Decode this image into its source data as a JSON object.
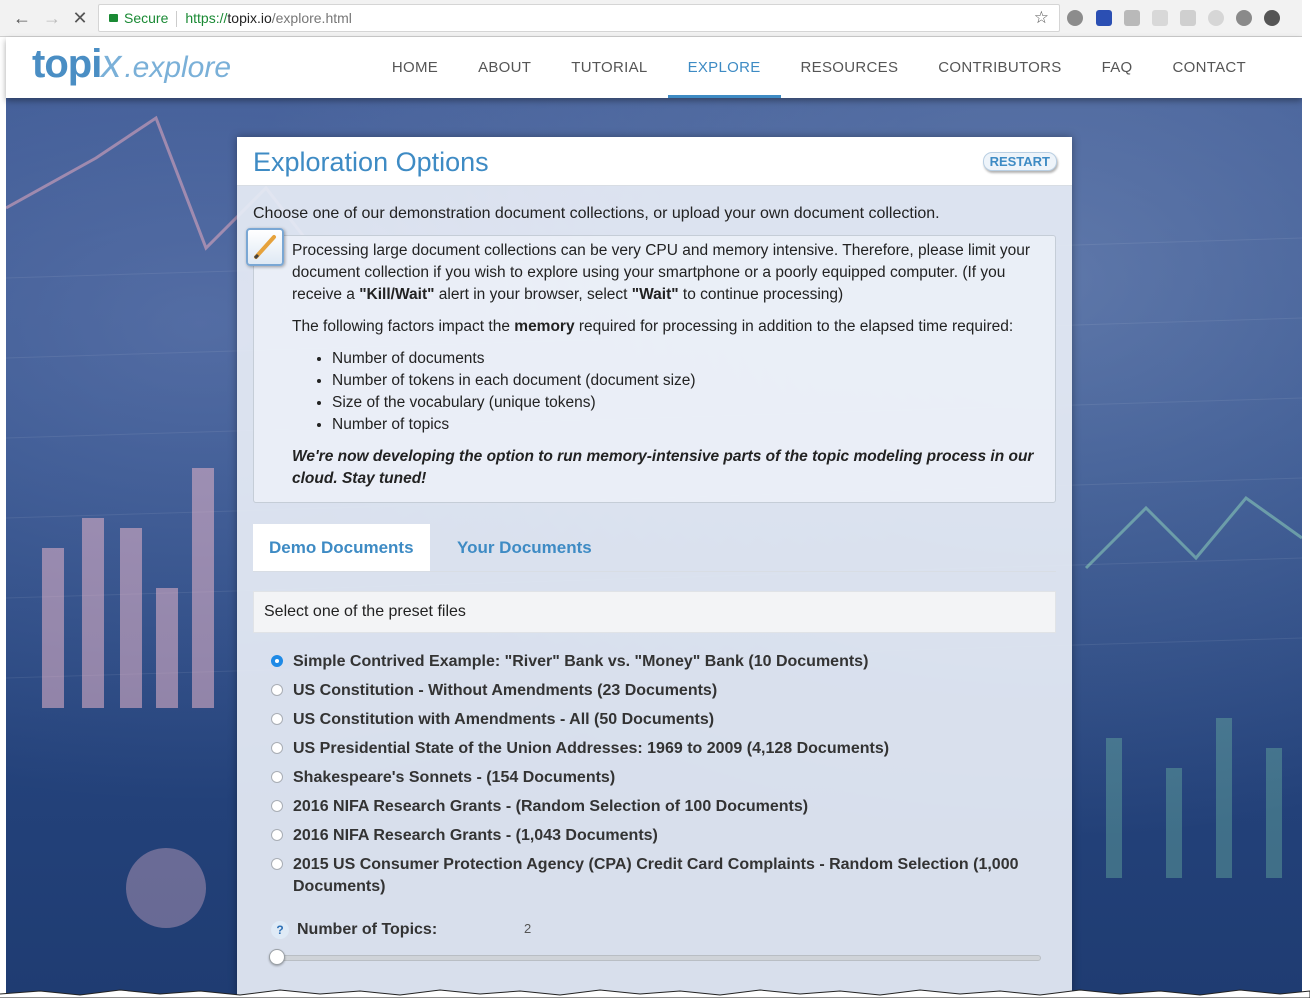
{
  "browser": {
    "secure_label": "Secure",
    "url_protocol": "https://",
    "url_host": "topix.io",
    "url_path": "/explore.html"
  },
  "site": {
    "logo_main": "topi",
    "logo_x": "x",
    "logo_sub": ".explore",
    "nav": [
      {
        "label": "HOME"
      },
      {
        "label": "ABOUT"
      },
      {
        "label": "TUTORIAL"
      },
      {
        "label": "EXPLORE",
        "active": true
      },
      {
        "label": "RESOURCES"
      },
      {
        "label": "CONTRIBUTORS"
      },
      {
        "label": "FAQ"
      },
      {
        "label": "CONTACT"
      }
    ]
  },
  "panel": {
    "title": "Exploration Options",
    "restart_label": "RESTART",
    "intro": "Choose one of our demonstration document collections, or upload your own document collection.",
    "note": {
      "p1_a": "Processing large document collections can be very CPU and memory intensive. Therefore, please limit your document collection if you wish to explore using your smartphone or a poorly equipped computer. (If you receive a ",
      "p1_kill": "\"Kill/Wait\"",
      "p1_b": " alert in your browser, select ",
      "p1_wait": "\"Wait\"",
      "p1_c": " to continue processing)",
      "p2_a": "The following factors impact the ",
      "p2_memory": "memory",
      "p2_b": " required for processing in addition to the elapsed time required:",
      "factors": [
        "Number of documents",
        "Number of tokens in each document (document size)",
        "Size of the vocabulary (unique tokens)",
        "Number of topics"
      ],
      "closing": "We're now developing the option to run memory-intensive parts of the topic modeling process in our cloud. Stay tuned!"
    },
    "tabs": [
      {
        "label": "Demo Documents",
        "active": true
      },
      {
        "label": "Your Documents"
      }
    ],
    "preset_heading": "Select one of the preset files",
    "presets": [
      {
        "label": "Simple Contrived Example: \"River\" Bank vs. \"Money\" Bank (10 Documents)",
        "checked": true
      },
      {
        "label": "US Constitution - Without Amendments (23 Documents)"
      },
      {
        "label": "US Constitution with Amendments - All (50 Documents)"
      },
      {
        "label": "US Presidential State of the Union Addresses: 1969 to 2009 (4,128 Documents)"
      },
      {
        "label": "Shakespeare's Sonnets - (154 Documents)"
      },
      {
        "label": "2016 NIFA Research Grants - (Random Selection of 100 Documents)"
      },
      {
        "label": "2016 NIFA Research Grants - (1,043 Documents)"
      },
      {
        "label": "2015 US Consumer Protection Agency (CPA) Credit Card Complaints - Random Selection (1,000 Documents)"
      }
    ],
    "topics": {
      "help_glyph": "?",
      "label": "Number of Topics:",
      "value": "2",
      "slider_fraction": 0.0
    }
  }
}
